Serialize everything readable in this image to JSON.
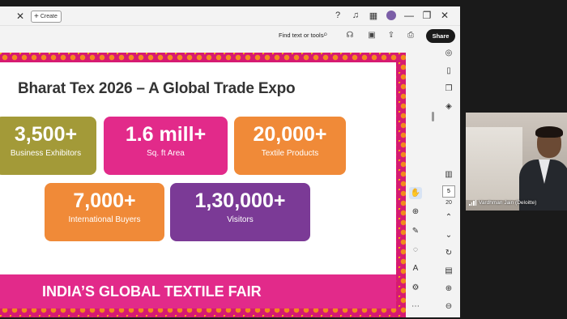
{
  "titlebar": {
    "close_glyph": "✕",
    "create_label": "Create",
    "icons": [
      "help-icon",
      "bell-icon",
      "apps-grid-icon",
      "user-avatar"
    ],
    "window_controls": [
      "—",
      "❐",
      "✕"
    ]
  },
  "toolbar": {
    "find_label": "Find text or tools",
    "share_label": "Share",
    "icons": [
      "search-icon",
      "headphones-icon",
      "save-icon",
      "upload-icon",
      "print-icon"
    ]
  },
  "slide": {
    "title": "Bharat Tex 2026 – A Global Trade Expo",
    "stats": [
      {
        "value": "3,500+",
        "label": "Business Exhibitors",
        "color": "#a39a38"
      },
      {
        "value": "1.6 mill+",
        "label": "Sq. ft Area",
        "color": "#e22a8a"
      },
      {
        "value": "20,000+",
        "label": "Textile Products",
        "color": "#f08a38"
      },
      {
        "value": "7,000+",
        "label": "International Buyers",
        "color": "#f08a38"
      },
      {
        "value": "1,30,000+",
        "label": "Visitors",
        "color": "#7b3a96"
      }
    ],
    "banner": "INDIA’S GLOBAL TEXTILE FAIR"
  },
  "sidebar": {
    "page_current": "5",
    "page_total": "20"
  },
  "video": {
    "participant_name": "Vardhman Jain (Deloitte)"
  },
  "colors": {
    "accent_pink": "#d61a72",
    "accent_orange": "#f08a38",
    "olive": "#a39a38",
    "purple": "#7b3a96"
  }
}
